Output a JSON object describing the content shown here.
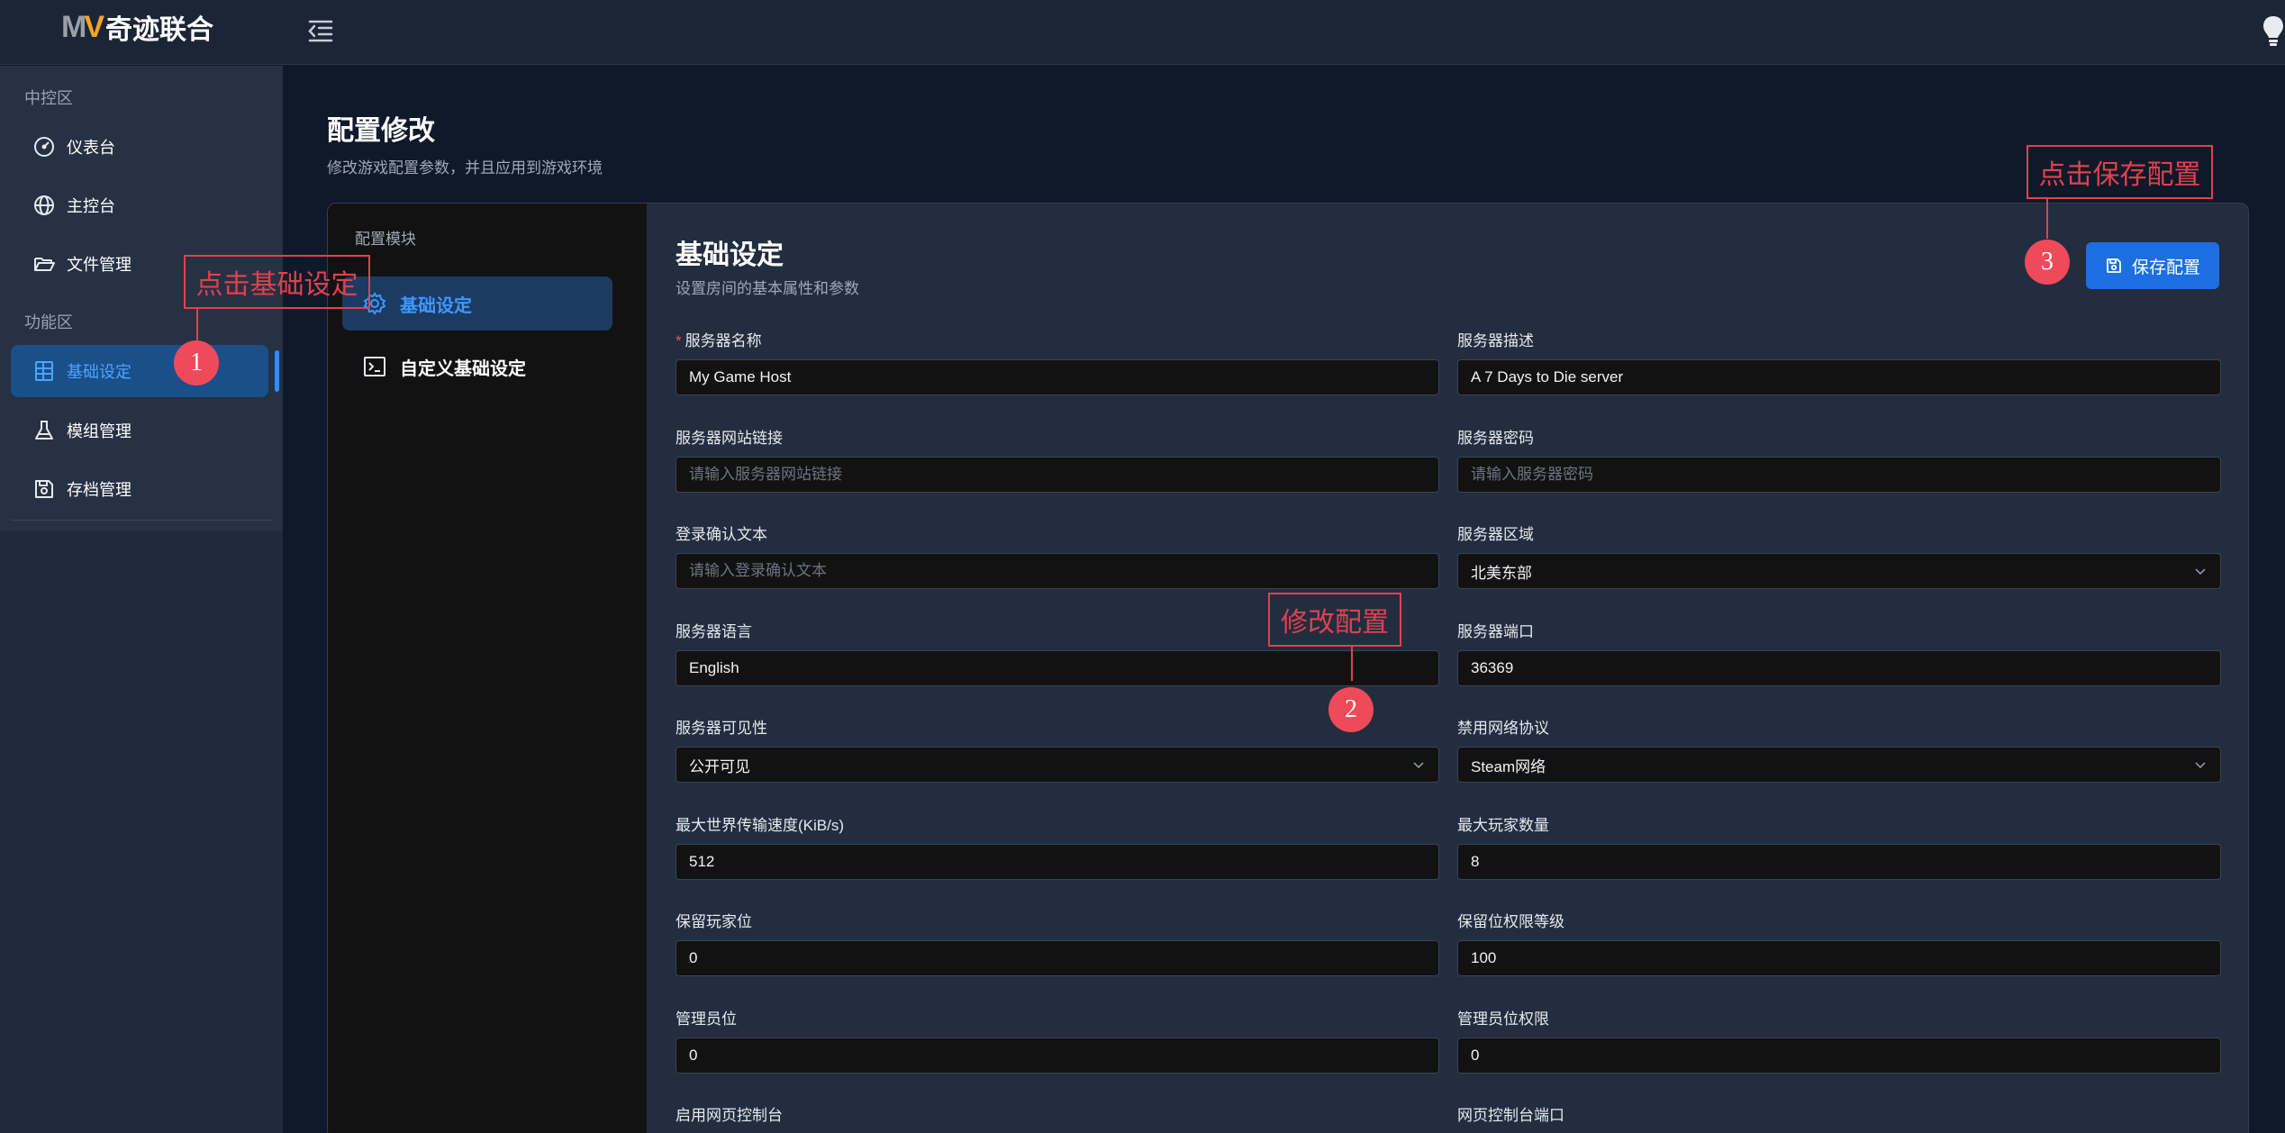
{
  "app": {
    "logo_mark": "MV",
    "logo_text": "奇迹联合"
  },
  "topbar": {
    "menu_toggle_icon": "menu-fold-icon",
    "theme_icon": "lightbulb-icon"
  },
  "sidebar": {
    "group_central": "中控区",
    "group_function": "功能区",
    "items": [
      {
        "label": "仪表台",
        "icon": "dashboard-icon"
      },
      {
        "label": "主控台",
        "icon": "globe-icon"
      },
      {
        "label": "文件管理",
        "icon": "folder-icon"
      },
      {
        "label": "基础设定",
        "icon": "server-icon",
        "active": true
      },
      {
        "label": "模组管理",
        "icon": "flask-icon"
      },
      {
        "label": "存档管理",
        "icon": "save-icon"
      }
    ]
  },
  "page": {
    "title": "配置修改",
    "subtitle": "修改游戏配置参数，并且应用到游戏环境"
  },
  "modules": {
    "title": "配置模块",
    "items": [
      {
        "label": "基础设定",
        "icon": "gear-icon",
        "active": true
      },
      {
        "label": "自定义基础设定",
        "icon": "terminal-icon"
      }
    ]
  },
  "section": {
    "title": "基础设定",
    "subtitle": "设置房间的基本属性和参数",
    "save_label": "保存配置"
  },
  "form": {
    "server_name": {
      "label": "服务器名称",
      "value": "My Game Host",
      "required": true
    },
    "server_desc": {
      "label": "服务器描述",
      "value": "A 7 Days to Die server"
    },
    "server_url": {
      "label": "服务器网站链接",
      "placeholder": "请输入服务器网站链接"
    },
    "server_password": {
      "label": "服务器密码",
      "placeholder": "请输入服务器密码"
    },
    "login_text": {
      "label": "登录确认文本",
      "placeholder": "请输入登录确认文本"
    },
    "server_region": {
      "label": "服务器区域",
      "value": "北美东部"
    },
    "server_language": {
      "label": "服务器语言",
      "value": "English"
    },
    "server_port": {
      "label": "服务器端口",
      "value": "36369"
    },
    "server_visibility": {
      "label": "服务器可见性",
      "value": "公开可见"
    },
    "disabled_protocol": {
      "label": "禁用网络协议",
      "value": "Steam网络"
    },
    "max_world_transfer": {
      "label": "最大世界传输速度(KiB/s)",
      "value": "512"
    },
    "max_players": {
      "label": "最大玩家数量",
      "value": "8"
    },
    "reserved_slots": {
      "label": "保留玩家位",
      "value": "0"
    },
    "reserved_perm_level": {
      "label": "保留位权限等级",
      "value": "100"
    },
    "admin_slots": {
      "label": "管理员位",
      "value": "0"
    },
    "admin_perm": {
      "label": "管理员位权限",
      "value": "0"
    },
    "web_console_enabled": {
      "label": "启用网页控制台"
    },
    "web_console_port": {
      "label": "网页控制台端口"
    }
  },
  "annotations": [
    {
      "text": "点击基础设定",
      "number": "1"
    },
    {
      "text": "修改配置",
      "number": "2"
    },
    {
      "text": "点击保存配置",
      "number": "3"
    }
  ],
  "colors": {
    "accent": "#1c6fe0",
    "annotation": "#e0414d",
    "background": "#0f1929"
  }
}
